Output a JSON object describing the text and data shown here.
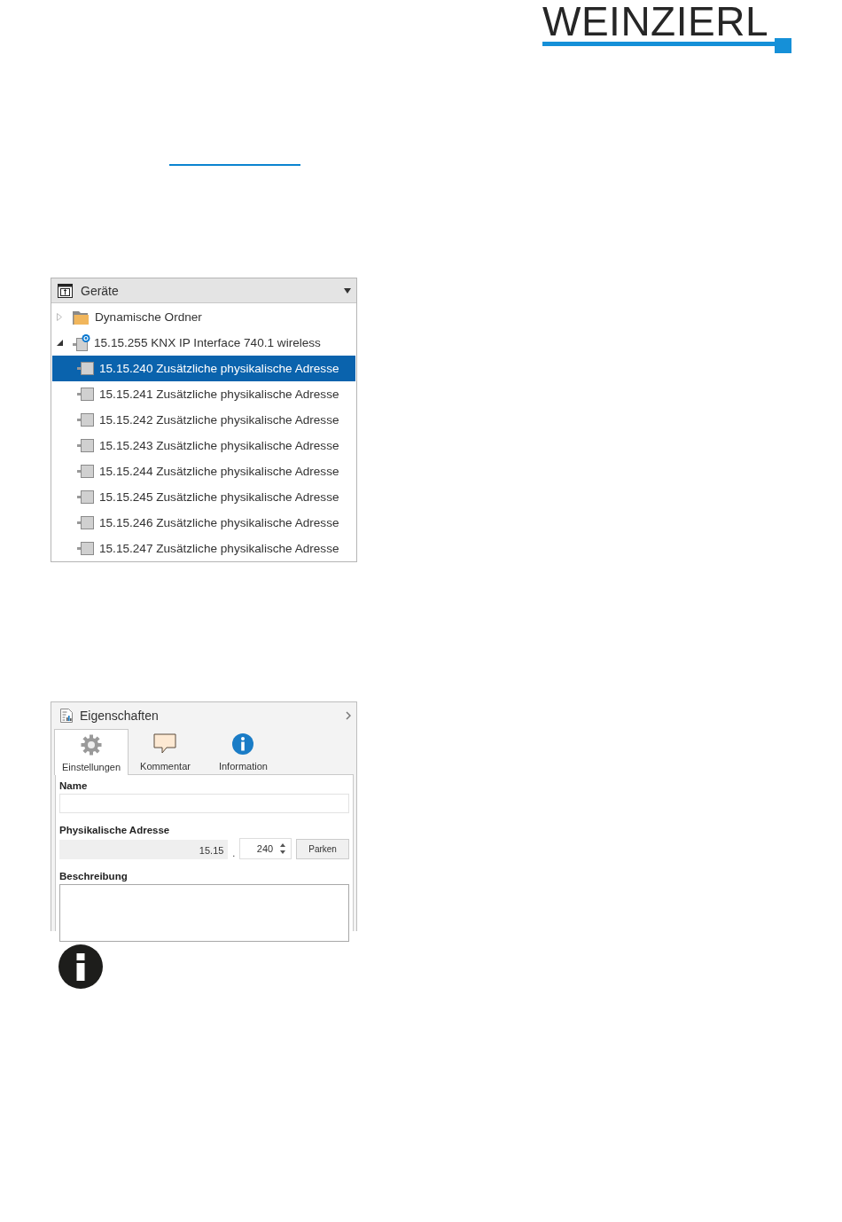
{
  "logo": {
    "text": "WEINZIERL"
  },
  "devices_panel": {
    "title": "Geräte",
    "tree": [
      {
        "label": "Dynamische Ordner",
        "kind": "folder",
        "expanded": false,
        "selected": false
      },
      {
        "label": "15.15.255 KNX IP Interface 740.1 wireless",
        "kind": "interface",
        "expanded": true,
        "selected": false,
        "children": [
          {
            "label": "15.15.240 Zusätzliche physikalische Adresse",
            "kind": "address",
            "selected": true
          },
          {
            "label": "15.15.241 Zusätzliche physikalische Adresse",
            "kind": "address",
            "selected": false
          },
          {
            "label": "15.15.242 Zusätzliche physikalische Adresse",
            "kind": "address",
            "selected": false
          },
          {
            "label": "15.15.243 Zusätzliche physikalische Adresse",
            "kind": "address",
            "selected": false
          },
          {
            "label": "15.15.244 Zusätzliche physikalische Adresse",
            "kind": "address",
            "selected": false
          },
          {
            "label": "15.15.245 Zusätzliche physikalische Adresse",
            "kind": "address",
            "selected": false
          },
          {
            "label": "15.15.246 Zusätzliche physikalische Adresse",
            "kind": "address",
            "selected": false
          },
          {
            "label": "15.15.247 Zusätzliche physikalische Adresse",
            "kind": "address",
            "selected": false
          }
        ]
      }
    ]
  },
  "properties_panel": {
    "title": "Eigenschaften",
    "tabs": [
      {
        "label": "Einstellungen",
        "kind": "settings",
        "selected": true
      },
      {
        "label": "Kommentar",
        "kind": "comment",
        "selected": false
      },
      {
        "label": "Information",
        "kind": "info",
        "selected": false
      }
    ],
    "name_label": "Name",
    "address_label": "Physikalische Adresse",
    "address_prefix": "15.15",
    "address_separator": ".",
    "address_value": "240",
    "park_button": "Parken",
    "description_label": "Beschreibung"
  }
}
